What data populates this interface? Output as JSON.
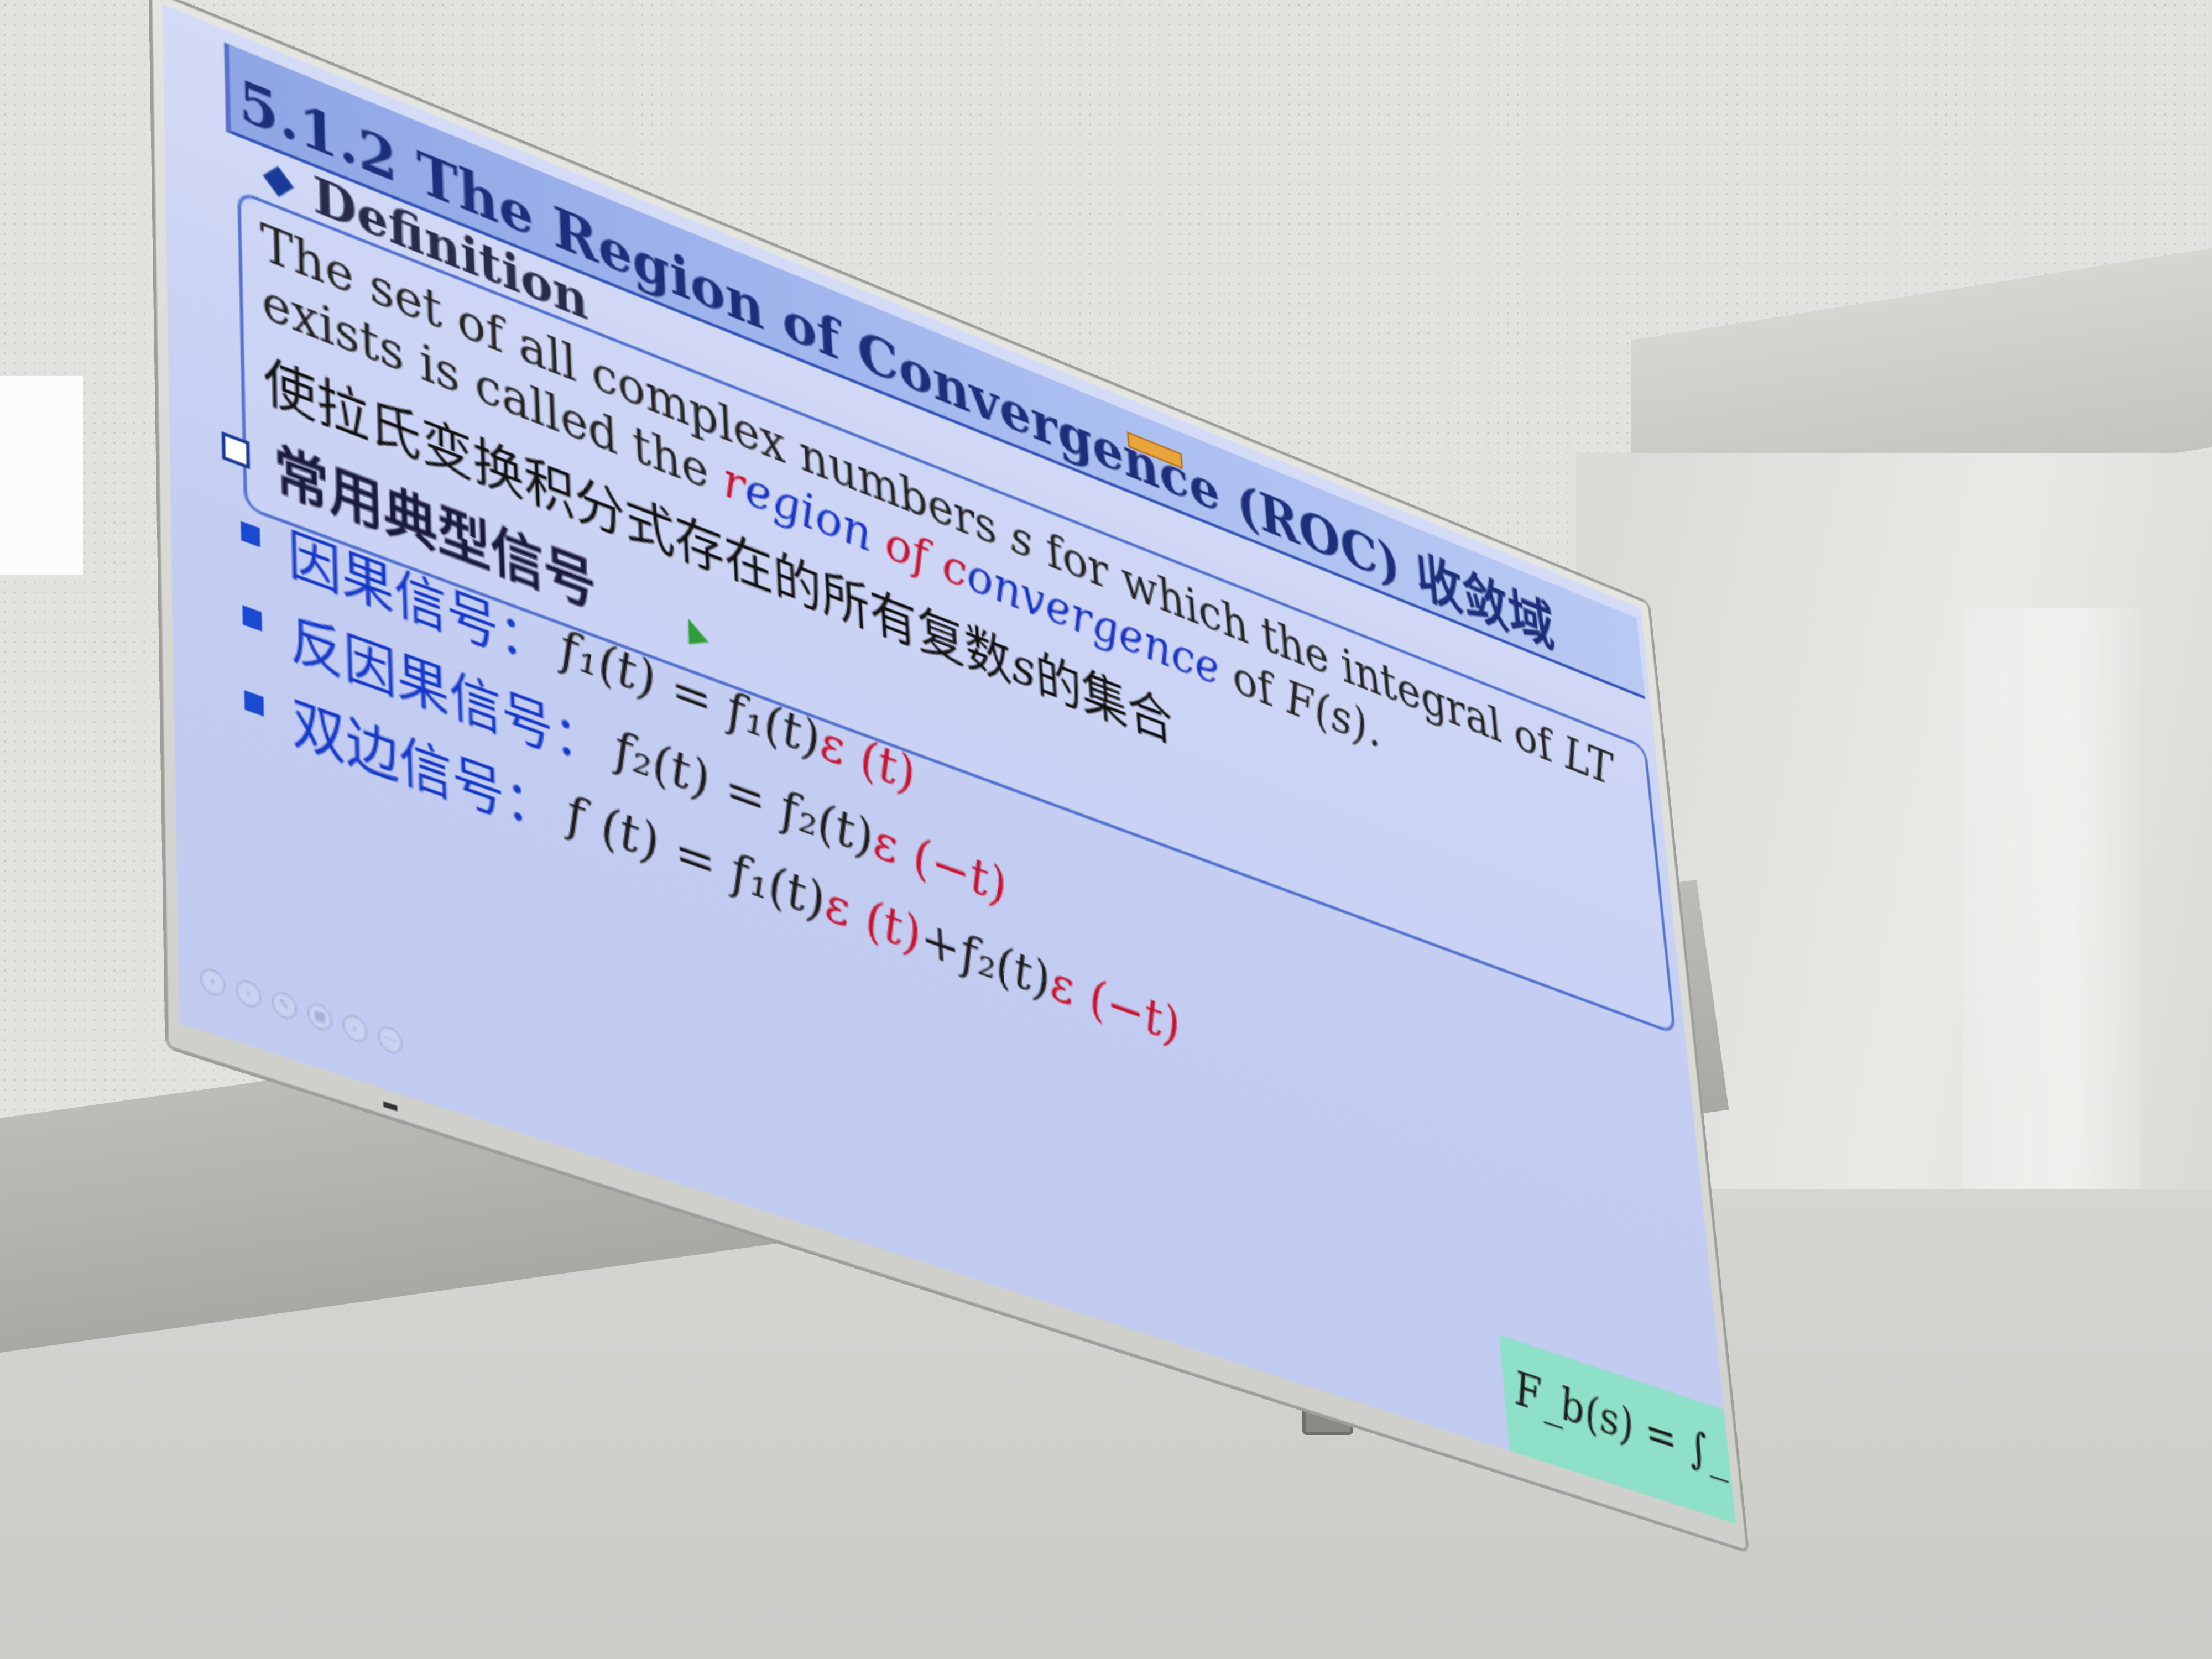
{
  "slide": {
    "title": "5.1.2 The Region of Convergence (ROC) ",
    "title_cn": "收敛域",
    "definition_label": "Definition",
    "definition_text_before": "The set of all complex numbers ",
    "definition_s": "s",
    "definition_text_mid": " for which the integral of ",
    "definition_lt": "LT",
    "definition_text_after": " exists is called the ",
    "definition_term_r": "r",
    "definition_term_egion": "egion ",
    "definition_term_of": "of",
    "definition_term_space": " ",
    "definition_term_c": "c",
    "definition_term_onvergence": "onvergence",
    "definition_text_end": " of ",
    "definition_Fs": "F(s).",
    "definition_cn_before": "使拉氏变换积分式存在的所有复数",
    "definition_cn_s": "s",
    "definition_cn_after": "的集合",
    "section_label": "常用典型信号",
    "items": [
      {
        "label": "因果信号：",
        "formula_a": "f₁(t) = f₁(t)",
        "formula_eps": "ε (t)",
        "formula_b": ""
      },
      {
        "label": "反因果信号：",
        "formula_a": "f₂(t) = f₂(t)",
        "formula_eps": "ε (−t)",
        "formula_b": ""
      },
      {
        "label": "双边信号：",
        "formula_a": "f (t) = f₁(t)",
        "formula_eps": "ε (t)",
        "formula_b": "+f₂(t)",
        "formula_eps2": "ε (−t)"
      }
    ],
    "fb_formula": "F_b(s) = ∫_{−∞}^{∞} f(t)e^{−st} dt"
  },
  "colors": {
    "title_bar": "#a9bdf0",
    "accent_blue": "#1538c8",
    "accent_red": "#c8102e",
    "formula_box": "#8fe0c8"
  },
  "toolbar_icons": [
    "prev-icon",
    "next-icon",
    "pen-icon",
    "slides-icon",
    "zoom-icon",
    "more-icon"
  ]
}
